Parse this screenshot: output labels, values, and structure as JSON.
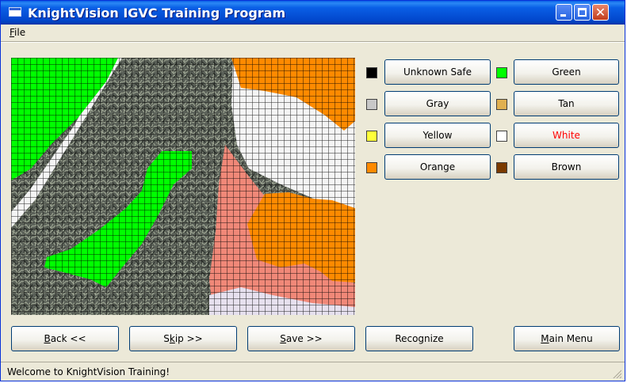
{
  "window": {
    "title": "KnightVision IGVC Training Program"
  },
  "menu": {
    "file_label": "File"
  },
  "colors": {
    "unknown_safe": "#000000",
    "gray": "#c8c8c8",
    "yellow": "#ffff3a",
    "orange": "#ff8a00",
    "green": "#00ff00",
    "tan": "#e0b050",
    "white": "#ffffff",
    "brown": "#7a3a00"
  },
  "class_buttons": {
    "unknown_safe": "Unknown Safe",
    "gray": "Gray",
    "yellow": "Yellow",
    "orange": "Orange",
    "green": "Green",
    "tan": "Tan",
    "white": "White",
    "brown": "Brown"
  },
  "selected_class": "White",
  "selected_text_color": "#ff0000",
  "actions": {
    "back": "Back <<",
    "skip": "Skip >>",
    "save": "Save >>",
    "recognize": "Recognize",
    "main_menu": "Main Menu"
  },
  "status": {
    "text": "Welcome to KnightVision Training!"
  }
}
